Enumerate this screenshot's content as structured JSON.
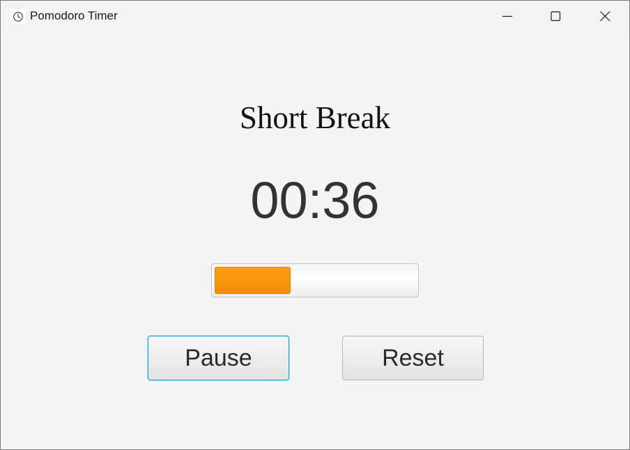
{
  "window": {
    "title": "Pomodoro Timer",
    "icon": "clock-icon"
  },
  "controls": {
    "minimize_icon": "minimize-icon",
    "maximize_icon": "maximize-icon",
    "close_icon": "close-icon"
  },
  "main": {
    "mode_title": "Short Break",
    "time_remaining": "00:36",
    "progress_fraction": 0.38,
    "progress_color": "#f39200"
  },
  "buttons": {
    "pause_label": "Pause",
    "reset_label": "Reset"
  }
}
